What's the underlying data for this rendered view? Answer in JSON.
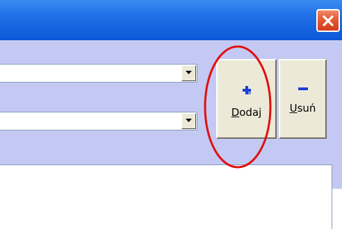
{
  "window": {
    "close_icon": "close-x-icon",
    "titlebar_color": "#1f6fe6",
    "close_color": "#e45a34"
  },
  "dialog": {
    "background": "#c4c9f3",
    "combo_1": {
      "value": "",
      "dropdown_icon": "chevron-down-icon"
    },
    "combo_2": {
      "value": "",
      "dropdown_icon": "chevron-down-icon"
    }
  },
  "buttons": {
    "add": {
      "label_mnemonic": "D",
      "label_rest": "odaj",
      "icon": "plus-icon",
      "icon_color": "#1a3fd6"
    },
    "remove": {
      "label_mnemonic": "U",
      "label_rest": "suń",
      "icon": "minus-icon",
      "icon_color": "#1a3fd6"
    }
  },
  "annotation": {
    "highlight_color": "#e01010",
    "target": "add"
  }
}
